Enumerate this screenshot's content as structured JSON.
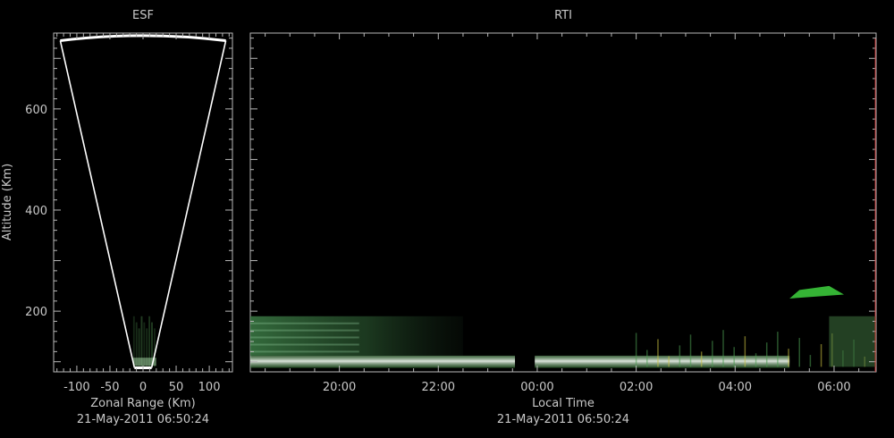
{
  "chart_data": [
    {
      "type": "scatter",
      "title": "ESF",
      "xlabel": "Zonal Range (Km)",
      "ylabel": "Altitude (Km)",
      "footer": "21-May-2011 06:50:24",
      "xlim": [
        -135,
        135
      ],
      "ylim": [
        80,
        750
      ],
      "xticks": [
        -100,
        -50,
        0,
        50,
        100
      ],
      "xtick_labels": [
        "-100",
        "-50",
        "0",
        "50",
        "100"
      ],
      "yticks": [
        200,
        400,
        600
      ],
      "ytick_labels": [
        "200",
        "400",
        "600"
      ],
      "beam_outline": {
        "left_edge": [
          [
            -13,
            88
          ],
          [
            -125,
            735
          ]
        ],
        "right_edge": [
          [
            13,
            88
          ],
          [
            125,
            735
          ]
        ],
        "top_arc_apex_altitude": 745
      },
      "echo_region": {
        "x_range": [
          -15,
          20
        ],
        "altitude_range": [
          90,
          190
        ],
        "color": "#3a6a3a"
      }
    },
    {
      "type": "heatmap",
      "title": "RTI",
      "xlabel": "Local Time",
      "footer": "21-May-2011 06:50:24",
      "ylim": [
        80,
        750
      ],
      "yticks": [
        200,
        400,
        600
      ],
      "xticks": [
        "20:00",
        "22:00",
        "00:00",
        "02:00",
        "04:00",
        "06:00"
      ],
      "time_range_hours": [
        18.2,
        30.85
      ],
      "current_time_marker": "06:50",
      "echoes": [
        {
          "t_start": 18.2,
          "t_end": 29.1,
          "alt_low": 88,
          "alt_high": 112,
          "color": "#d8e8d8",
          "note": "bright E-region layer"
        },
        {
          "t_start": 18.2,
          "t_end": 22.5,
          "alt_low": 112,
          "alt_high": 190,
          "color": "#2e6e3a",
          "note": "diffuse green echoes"
        },
        {
          "t_start": 29.1,
          "t_end": 30.2,
          "alt_low": 225,
          "alt_high": 250,
          "color": "#3ed23e",
          "note": "green F-region patch"
        }
      ],
      "data_gap": {
        "t_start": 23.55,
        "t_end": 23.95
      }
    }
  ]
}
